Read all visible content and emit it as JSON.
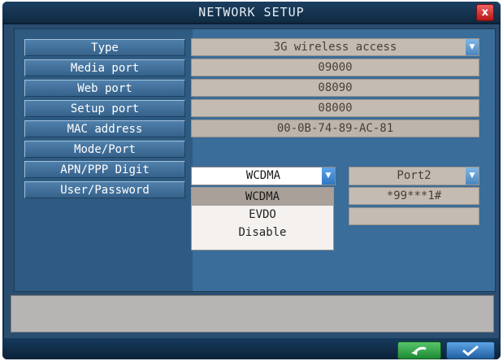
{
  "window": {
    "title": "NETWORK SETUP",
    "close_glyph": "x"
  },
  "labels": {
    "type": "Type",
    "media_port": "Media port",
    "web_port": "Web port",
    "setup_port": "Setup port",
    "mac_address": "MAC address",
    "mode_port": "Mode/Port",
    "apn_ppp_digit": "APN/PPP Digit",
    "user_password": "User/Password"
  },
  "fields": {
    "type_value": "3G wireless access",
    "media_port_value": "09000",
    "web_port_value": "08090",
    "setup_port_value": "08000",
    "mac_address_value": "00-0B-74-89-AC-81",
    "mode_value": "WCDMA",
    "port_value": "Port2",
    "ppp_digit_value": "*99***1#",
    "password_value": ""
  },
  "mode_dropdown": {
    "options": [
      "WCDMA",
      "EVDO",
      "Disable"
    ],
    "selected": "WCDMA"
  },
  "icons": {
    "close": "close-icon",
    "select_arrow": "chevron-down-icon",
    "back": "return-arrow-icon",
    "confirm": "checkmark-icon"
  },
  "colors": {
    "window_bg": "#2a4e70",
    "field_bg": "#c4bbb3",
    "confirm_button": "#215f9f",
    "back_button": "#1f8a35",
    "close_button": "#b81818"
  }
}
